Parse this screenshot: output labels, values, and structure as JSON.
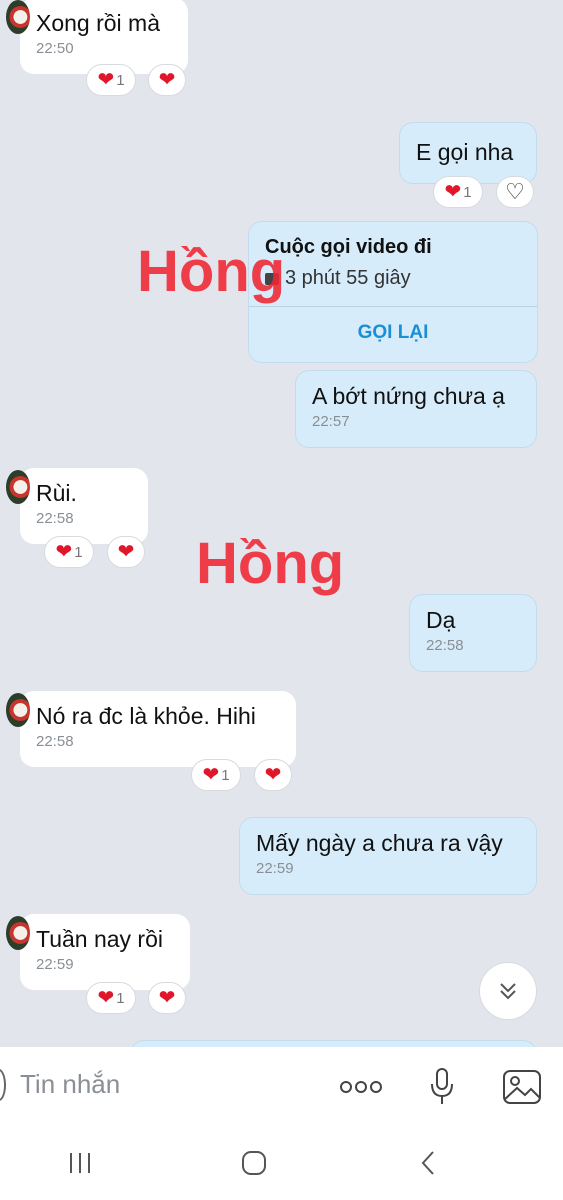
{
  "watermarks": [
    "Hồng",
    "Hồng"
  ],
  "messages": [
    {
      "text": "Xong rồi mà",
      "time": "22:50",
      "reaction_count": "1"
    },
    {
      "text": "E gọi nha",
      "reaction_count": "1"
    },
    {
      "text": "A bớt nứng chưa ạ",
      "time": "22:57"
    },
    {
      "text": "Rùi.",
      "time": "22:58",
      "reaction_count": "1"
    },
    {
      "text": "Dạ",
      "time": "22:58"
    },
    {
      "text": "Nó ra đc là khỏe. Hihi",
      "time": "22:58",
      "reaction_count": "1"
    },
    {
      "text": "Mấy ngày a chưa ra vậy",
      "time": "22:59"
    },
    {
      "text": "Tuần nay rồi",
      "time": "22:59",
      "reaction_count": "1"
    }
  ],
  "call_card": {
    "title": "Cuộc gọi video đi",
    "duration": "3 phút 55 giây",
    "callback_label": "GỌI LẠI"
  },
  "input": {
    "placeholder": "Tin nhắn",
    "icons": [
      "more-icon",
      "microphone-icon",
      "image-icon"
    ]
  },
  "navbar": {
    "icons": [
      "recent-apps-icon",
      "home-icon",
      "back-icon"
    ]
  },
  "colors": {
    "background": "#e2e6ec",
    "incoming_bubble": "#ffffff",
    "outgoing_bubble": "#d6ecfa",
    "accent": "#1a8fd6",
    "heart": "#e0162b",
    "watermark": "#f02633"
  }
}
